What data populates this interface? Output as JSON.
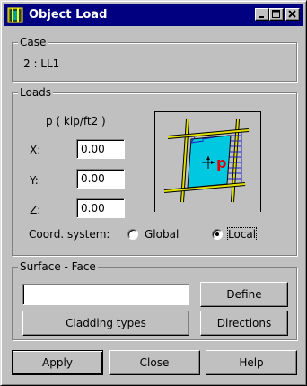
{
  "window": {
    "title": "Object Load",
    "minimize_icon": "minimize-icon",
    "maximize_icon": "maximize-icon",
    "close_icon": "close-icon"
  },
  "case": {
    "group_label": "Case",
    "value": "2 : LL1"
  },
  "loads": {
    "group_label": "Loads",
    "unit_label": "p   ( kip/ft2 )",
    "x_label": "X:",
    "x_value": "0.00",
    "y_label": "Y:",
    "y_value": "0.00",
    "z_label": "Z:",
    "z_value": "0.00",
    "coord_label": "Coord. system:",
    "global_label": "Global",
    "local_label": "Local",
    "selected": "Local",
    "diagram_letter": "p"
  },
  "surface": {
    "group_label": "Surface - Face",
    "input_value": "",
    "define_label": "Define",
    "cladding_label": "Cladding types",
    "directions_label": "Directions"
  },
  "footer": {
    "apply_label": "Apply",
    "close_label": "Close",
    "help_label": "Help"
  },
  "colors": {
    "titlebar": "#000080",
    "panel": "#c0c0c0",
    "diagram_plate": "#00c8e0",
    "diagram_arrows": "#2020c0",
    "diagram_bars": "#e0e000",
    "diagram_letter": "#e00000"
  }
}
